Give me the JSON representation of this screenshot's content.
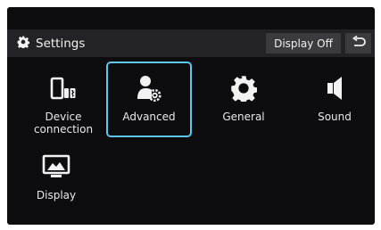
{
  "header": {
    "title": "Settings",
    "title_icon": "gear-icon",
    "display_off_label": "Display Off",
    "back_icon": "back-arrow-icon"
  },
  "tiles": [
    {
      "label": "Device\nconnection",
      "icon": "device-connection-icon",
      "selected": false
    },
    {
      "label": "Advanced",
      "icon": "advanced-user-gear-icon",
      "selected": true
    },
    {
      "label": "General",
      "icon": "gear-icon",
      "selected": false
    },
    {
      "label": "Sound",
      "icon": "speaker-icon",
      "selected": false
    },
    {
      "label": "Display",
      "icon": "monitor-icon",
      "selected": false
    }
  ],
  "colors": {
    "background": "#0d0d0f",
    "header": "#232327",
    "button": "#3a3a3f",
    "selection": "#5ec5ee",
    "text": "#e9e9e9"
  }
}
